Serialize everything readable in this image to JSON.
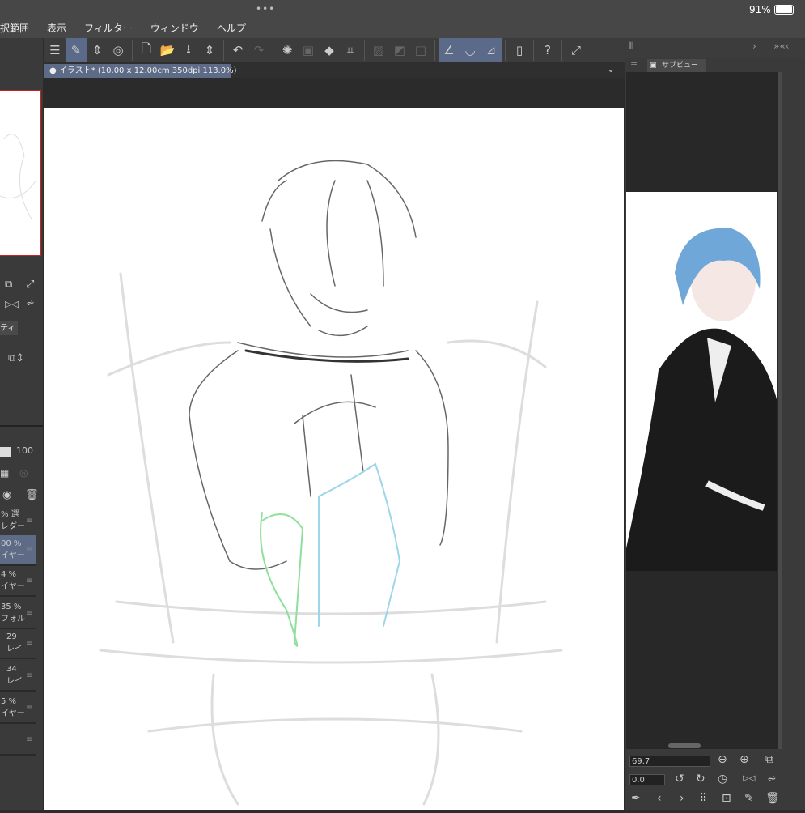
{
  "status": {
    "dots": "•••",
    "battery": "91%"
  },
  "menu": [
    "択範囲",
    "表示",
    "フィルター",
    "ウィンドウ",
    "ヘルプ"
  ],
  "document_tab": {
    "label": "イラスト* (10.00 x 12.00cm 350dpi 113.0%)"
  },
  "subview": {
    "tab_label": "サブビュー",
    "zoom_value": "69.7",
    "rotate_value": "0.0"
  },
  "layer_panel": {
    "opacity": "100",
    "tab_label": "ティ",
    "layers": [
      {
        "pct": "% 選",
        "name": "レダー"
      },
      {
        "pct": "00 %",
        "name": "イヤー",
        "selected": true
      },
      {
        "pct": "4 %",
        "name": "イヤー"
      },
      {
        "pct": "35 %",
        "name": "フォル"
      },
      {
        "pct": "29",
        "name": "レイ"
      },
      {
        "pct": "34",
        "name": "レイ"
      },
      {
        "pct": "5 %",
        "name": "イヤー"
      },
      {
        "pct": "",
        "name": ""
      }
    ]
  },
  "colors": {
    "accent": "#5d6b86",
    "navigator_frame": "#cc2222",
    "sketch_green": "#7ddc8a",
    "sketch_blue": "#8fd0e4"
  }
}
